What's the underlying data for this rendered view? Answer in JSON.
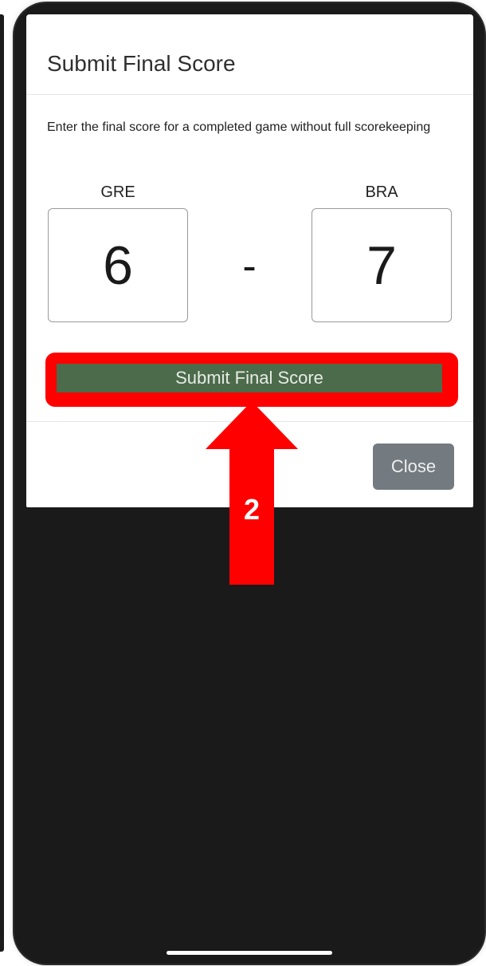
{
  "modal": {
    "title": "Submit Final Score",
    "description": "Enter the final score for a completed game without full scorekeeping",
    "home_team": "GRE",
    "away_team": "BRA",
    "home_score": "6",
    "away_score": "7",
    "separator": "-",
    "submit_label": "Submit Final Score",
    "close_label": "Close"
  },
  "annotation": {
    "step_number": "2",
    "highlight_color": "#ff0000",
    "arrow_icon": "up-arrow-icon"
  },
  "colors": {
    "submit_button": "#4b6b4a",
    "close_button": "#737a80",
    "background": "#1a1a1a"
  }
}
